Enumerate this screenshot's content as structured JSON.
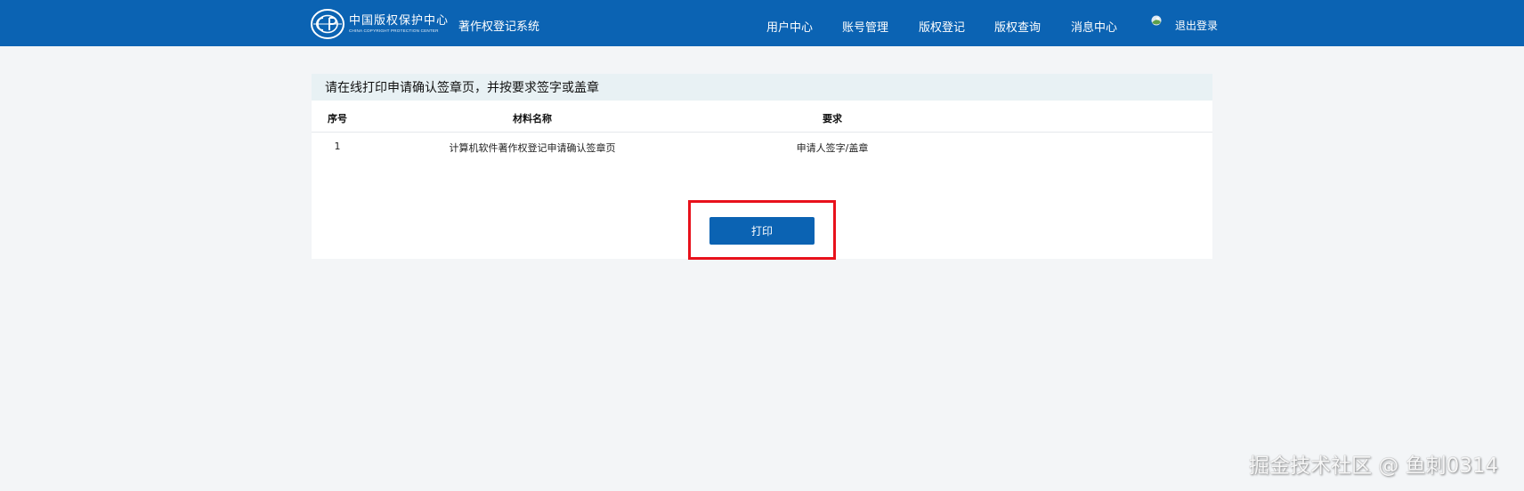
{
  "header": {
    "logo_cn": "中国版权保护中心",
    "logo_en": "CHINA COPYRIGHT PROTECTION CENTER",
    "system_title": "著作权登记系统",
    "nav": [
      "用户中心",
      "账号管理",
      "版权登记",
      "版权查询",
      "消息中心"
    ],
    "logout_label": "退出登录"
  },
  "panel": {
    "title": "请在线打印申请确认签章页，并按要求签字或盖章",
    "columns": [
      "序号",
      "材料名称",
      "要求"
    ],
    "rows": [
      {
        "index": "1",
        "name": "计算机软件著作权登记申请确认签章页",
        "requirement": "申请人签字/盖章"
      }
    ],
    "print_label": "打印"
  },
  "watermark": "掘金技术社区 @ 鱼刺0314",
  "colors": {
    "header_bg": "#0b63b3",
    "page_bg": "#f3f5f7",
    "panel_header_bg": "#e8f1f4",
    "button_bg": "#0b63b3",
    "highlight": "#e8111b"
  }
}
